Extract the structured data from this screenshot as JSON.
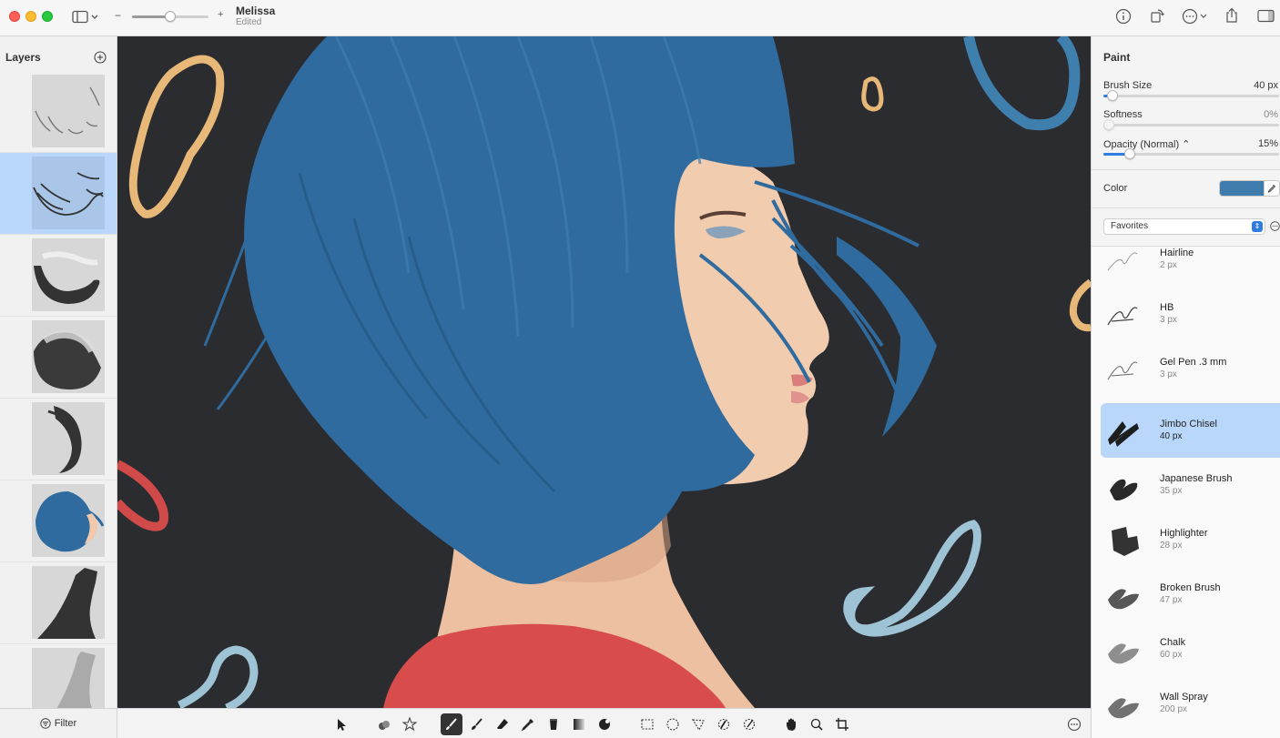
{
  "window": {
    "title": "Melissa",
    "subtitle": "Edited",
    "zoom_minus": "−",
    "zoom_plus": "+",
    "zoom_level": 0.5
  },
  "layers_panel": {
    "title": "Layers",
    "filter_label": "Filter",
    "selected_index": 1,
    "layer_count": 8
  },
  "inspector": {
    "title": "Paint",
    "brush_size": {
      "label": "Brush Size",
      "value": "40 px",
      "fraction": 0.05
    },
    "softness": {
      "label": "Softness",
      "value": "0%",
      "fraction": 0.0
    },
    "opacity": {
      "label": "Opacity (Normal) ⌃",
      "value": "15%",
      "fraction": 0.15
    },
    "color": {
      "label": "Color",
      "swatch": "#3d7cad"
    },
    "brush_set": {
      "selected": "Favorites"
    },
    "brushes": [
      {
        "name": "Hairline",
        "size": "2 px",
        "selected": false
      },
      {
        "name": "HB",
        "size": "3 px",
        "selected": false
      },
      {
        "name": "Gel Pen .3 mm",
        "size": "3 px",
        "selected": false
      },
      {
        "name": "Jimbo Chisel",
        "size": "40 px",
        "selected": true
      },
      {
        "name": "Japanese Brush",
        "size": "35 px",
        "selected": false
      },
      {
        "name": "Highlighter",
        "size": "28 px",
        "selected": false
      },
      {
        "name": "Broken Brush",
        "size": "47 px",
        "selected": false
      },
      {
        "name": "Chalk",
        "size": "60 px",
        "selected": false
      },
      {
        "name": "Wall Spray",
        "size": "200 px",
        "selected": false
      }
    ]
  },
  "colors": {
    "accent": "#2f7de1",
    "selection": "#b9d7fb",
    "canvas_bg": "#2b2c30",
    "hair": "#2f6b9e",
    "skin": "#f0c9ac",
    "shirt": "#d84c4c"
  },
  "toolbar": {
    "active_tool": "paint-brush"
  }
}
